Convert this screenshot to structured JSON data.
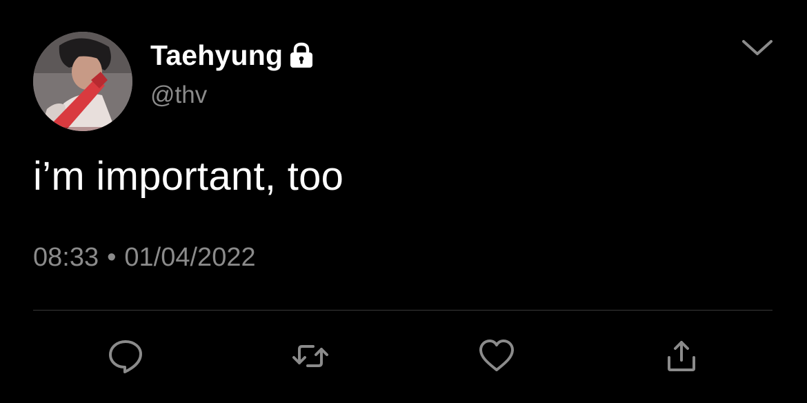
{
  "user": {
    "display_name": "Taehyung",
    "handle": "@thv",
    "protected_icon": "lock-icon",
    "avatar": "profile-photo"
  },
  "tweet": {
    "text": "i’m important, too",
    "time": "08:33",
    "separator": "•",
    "date": "01/04/2022"
  },
  "actions": [
    {
      "name": "reply",
      "icon": "reply-icon"
    },
    {
      "name": "retweet",
      "icon": "retweet-icon"
    },
    {
      "name": "like",
      "icon": "heart-icon"
    },
    {
      "name": "share",
      "icon": "share-icon"
    }
  ],
  "menu_icon": "chevron-down-icon",
  "colors": {
    "background": "#000000",
    "primary_text": "#ffffff",
    "secondary_text": "#8b8b8b",
    "icon": "#8b8b8b",
    "divider": "#3a3a3a"
  }
}
